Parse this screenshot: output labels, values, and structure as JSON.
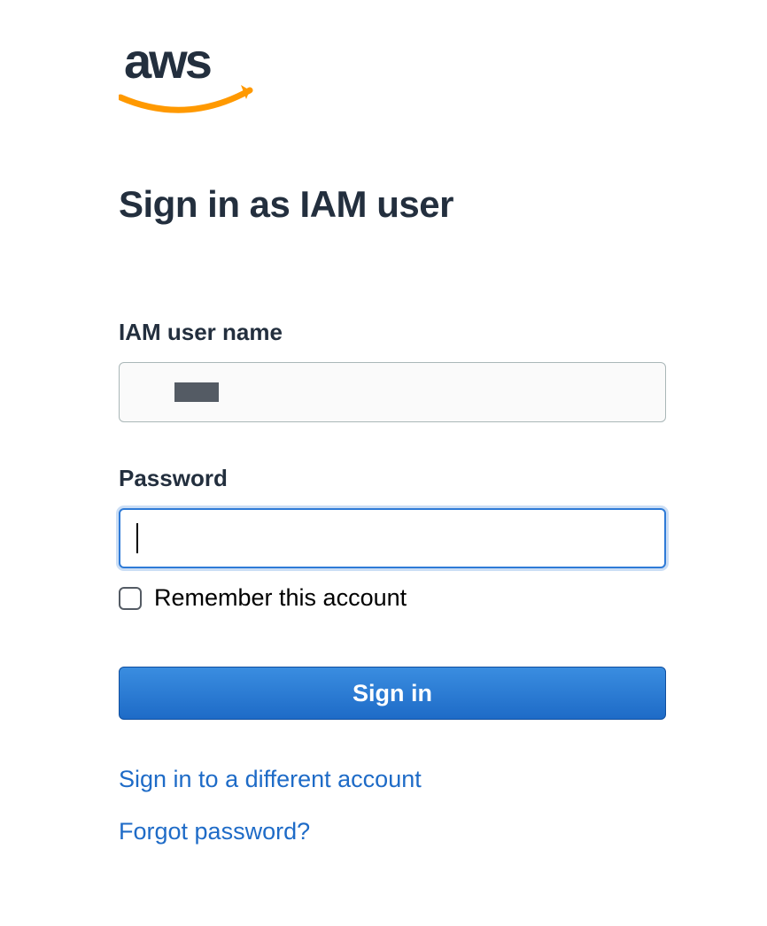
{
  "logo": {
    "text": "aws"
  },
  "title": "Sign in as IAM user",
  "fields": {
    "username": {
      "label": "IAM user name",
      "value": ""
    },
    "password": {
      "label": "Password",
      "value": ""
    }
  },
  "remember": {
    "label": "Remember this account",
    "checked": false
  },
  "buttons": {
    "signin": "Sign in"
  },
  "links": {
    "different_account": "Sign in to a different account",
    "forgot_password": "Forgot password?"
  }
}
